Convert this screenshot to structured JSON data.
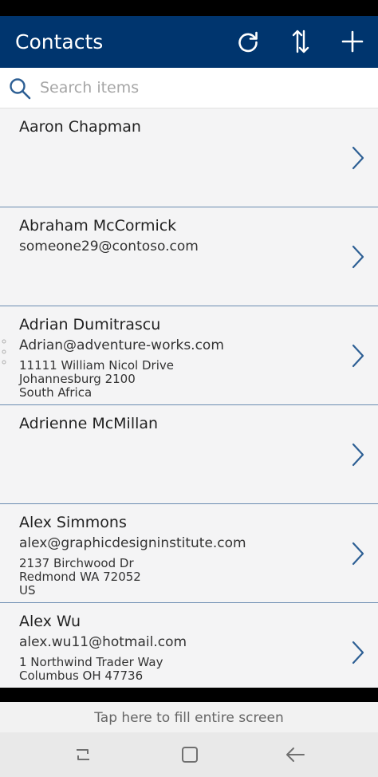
{
  "header": {
    "title": "Contacts",
    "background_color": "#00356e",
    "actions": [
      {
        "icon": "refresh-icon",
        "label": "Refresh"
      },
      {
        "icon": "sort-icon",
        "label": "Sort"
      },
      {
        "icon": "add-icon",
        "label": "Add"
      }
    ]
  },
  "search": {
    "placeholder": "Search items",
    "value": "",
    "icon": "search-icon"
  },
  "contacts": [
    {
      "name": "Aaron Chapman",
      "email": "",
      "address": []
    },
    {
      "name": "Abraham McCormick",
      "email": "someone29@contoso.com",
      "address": []
    },
    {
      "name": "Adrian Dumitrascu",
      "email": "Adrian@adventure-works.com",
      "address": [
        "11111 William Nicol Drive",
        "Johannesburg 2100",
        "South Africa"
      ]
    },
    {
      "name": "Adrienne McMillan",
      "email": "",
      "address": []
    },
    {
      "name": "Alex Simmons",
      "email": "alex@graphicdesigninstitute.com",
      "address": [
        "2137 Birchwood Dr",
        "Redmond WA 72052",
        "US"
      ]
    },
    {
      "name": "Alex Wu",
      "email": "alex.wu11@hotmail.com",
      "address": [
        "1 Northwind Trader Way",
        "Columbus OH 47736"
      ]
    }
  ],
  "fill_screen": {
    "label": "Tap here to fill entire screen"
  },
  "nav": {
    "items": [
      {
        "icon": "recents-icon"
      },
      {
        "icon": "home-icon"
      },
      {
        "icon": "back-icon"
      }
    ]
  },
  "colors": {
    "accent": "#00356e",
    "chevron": "#2d5f94",
    "divider": "#6a8bb0",
    "list_background": "#f4f4f5"
  }
}
